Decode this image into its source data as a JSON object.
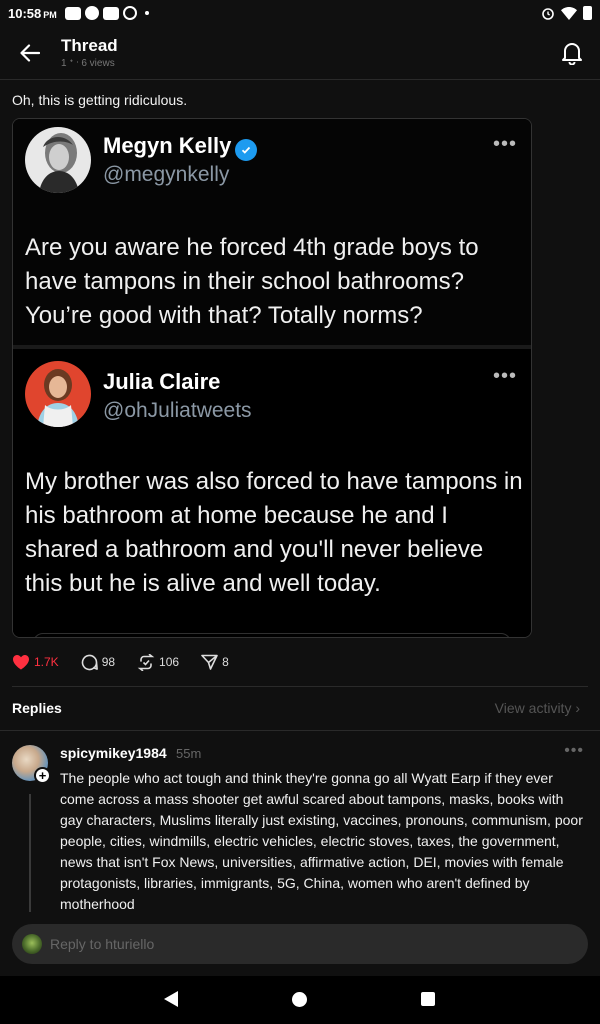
{
  "status_bar": {
    "time": "10:58",
    "ampm": "PM"
  },
  "header": {
    "title": "Thread",
    "subtitle": "1 ᐩ  ᐧ 6 views"
  },
  "post": {
    "text": "Oh, this is getting ridiculous.",
    "embed": {
      "tweets": [
        {
          "name": "Megyn Kelly",
          "verified": true,
          "handle": "@megynkelly",
          "body": "Are you aware he forced 4th grade boys to have tampons in their school bathrooms? You’re good with that? Totally norms?"
        },
        {
          "name": "Julia Claire",
          "verified": false,
          "handle": "@ohJuliatweets",
          "body": "My brother was also forced to have tampons in his bathroom at home because he and I shared a bathroom and you'll never believe this but he is alive and well today."
        }
      ]
    },
    "actions": {
      "likes": "1.7K",
      "comments": "98",
      "reposts": "106",
      "shares": "8"
    }
  },
  "replies_section": {
    "title": "Replies",
    "view_activity": "View activity ›"
  },
  "reply": {
    "username": "spicymikey1984",
    "time": "55m",
    "more": "•••",
    "body": "The people who act tough and think they're gonna go all Wyatt Earp if they ever come across a mass shooter get awful scared about tampons, masks, books with gay characters, Muslims literally just existing, vaccines, pronouns, communism, poor people, cities, windmills, electric vehicles, electric stoves, taxes, the government, news that isn't Fox News, universities, affirmative action, DEI, movies with female protagonists, libraries, immigrants, 5G, China, women who aren't defined by motherhood"
  },
  "composer": {
    "placeholder": "Reply to hturiello"
  },
  "colors": {
    "background": "#101010",
    "like_red": "#ff3040",
    "verified_blue": "#1d9bf0",
    "handle_gray": "#8b98a5"
  },
  "icons": [
    "back-arrow-icon",
    "bell-icon",
    "heart-icon",
    "comment-icon",
    "repost-icon",
    "share-icon",
    "verified-badge-icon",
    "more-icon",
    "plus-icon"
  ]
}
